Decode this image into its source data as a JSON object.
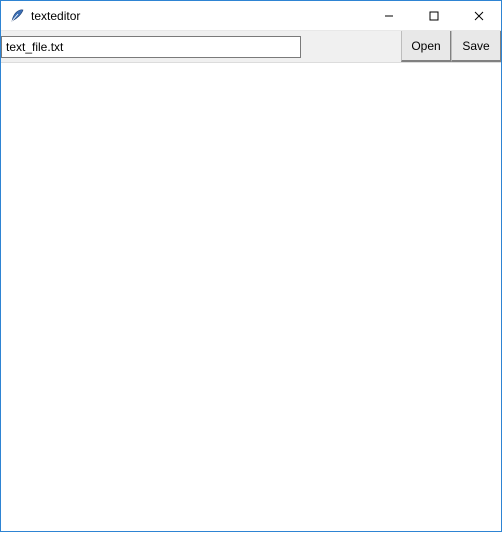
{
  "window": {
    "title": "texteditor"
  },
  "toolbar": {
    "filename_value": "text_file.txt",
    "open_label": "Open",
    "save_label": "Save"
  },
  "editor": {
    "content": ""
  }
}
